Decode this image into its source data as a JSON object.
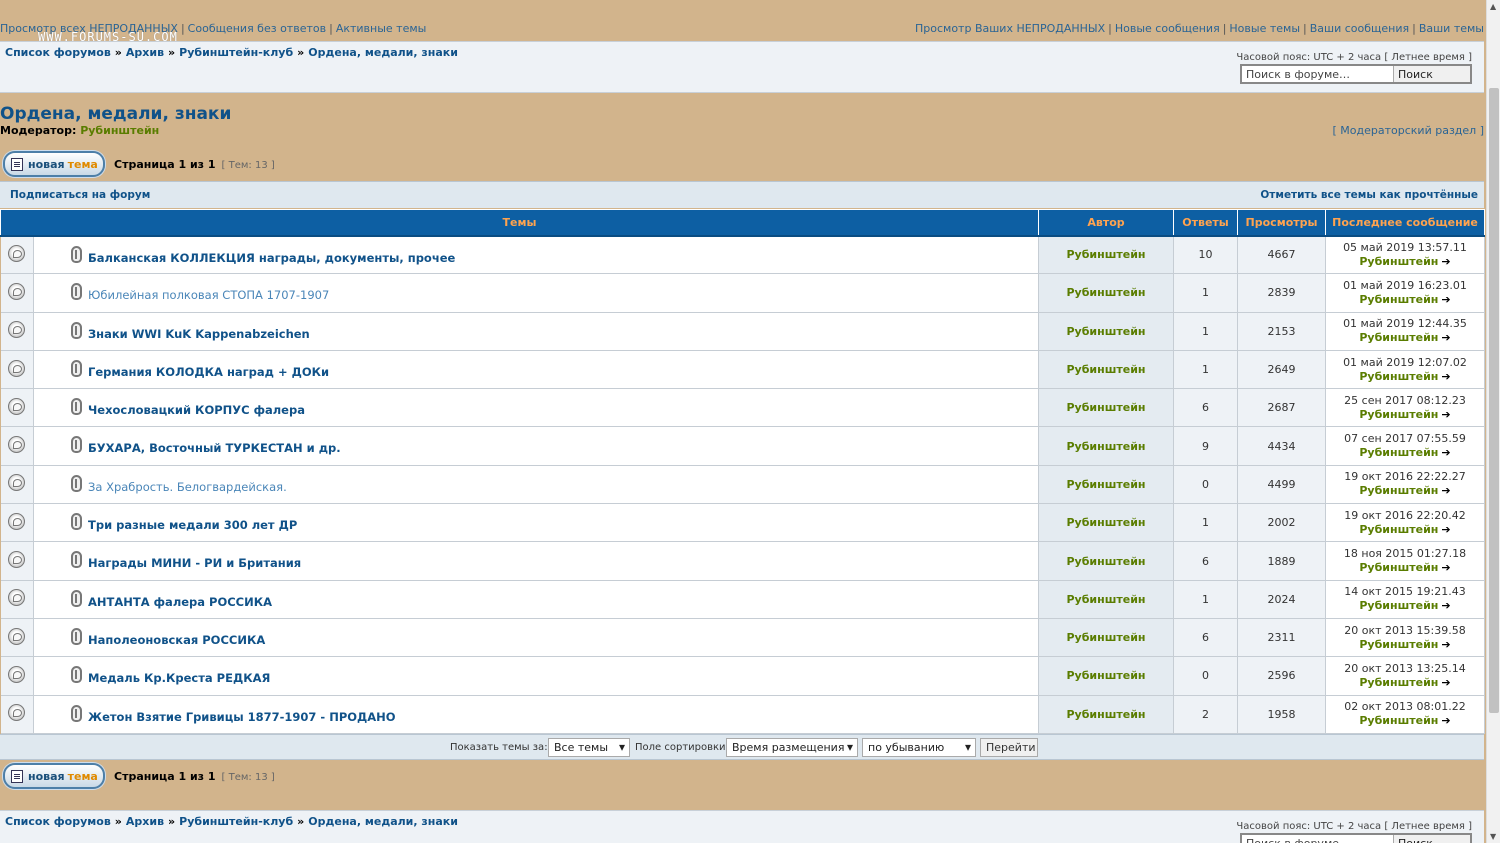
{
  "topnav": {
    "left": [
      "Просмотр всех НЕПРОДАННЫХ",
      "Сообщения без ответов",
      "Активные темы"
    ],
    "right": [
      "Просмотр Ваших НЕПРОДАННЫХ",
      "Новые сообщения",
      "Новые темы",
      "Ваши сообщения",
      "Ваши темы"
    ],
    "watermark": "WWW.FORUMS-SU.COM"
  },
  "breadcrumb": [
    "Список форумов",
    "Архив",
    "Рубинштейн-клуб",
    "Ордена, медали, знаки"
  ],
  "timezone": "Часовой пояс: UTC + 2 часа [ Летнее время ]",
  "search": {
    "placeholder": "Поиск в форуме…",
    "button": "Поиск"
  },
  "forum": {
    "title": "Ордена, медали, знаки",
    "moderator_label": "Модератор:",
    "moderator_name": "Рубинштейн",
    "mod_section": "[ Модераторский раздел ]"
  },
  "new_topic": {
    "part1": "новая",
    "part2": "тема"
  },
  "pagination": {
    "page": "Страница 1 из 1",
    "count": "[ Тем: 13 ]"
  },
  "subscribe": "Подписаться на форум",
  "mark_read": "Отметить все темы как прочтённые",
  "columns": [
    "Темы",
    "Автор",
    "Ответы",
    "Просмотры",
    "Последнее сообщение"
  ],
  "topics": [
    {
      "title": "Балканская КОЛЛЕКЦИЯ награды, документы, прочее",
      "visited": false,
      "author": "Рубинштейн",
      "replies": "10",
      "views": "4667",
      "last_date": "05 май 2019 13:57.11",
      "last_by": "Рубинштейн"
    },
    {
      "title": "Юбилейная полковая СТОПА 1707-1907",
      "visited": true,
      "author": "Рубинштейн",
      "replies": "1",
      "views": "2839",
      "last_date": "01 май 2019 16:23.01",
      "last_by": "Рубинштейн"
    },
    {
      "title": "Знаки WWI KuK Kappenabzeichen",
      "visited": false,
      "author": "Рубинштейн",
      "replies": "1",
      "views": "2153",
      "last_date": "01 май 2019 12:44.35",
      "last_by": "Рубинштейн"
    },
    {
      "title": "Германия КОЛОДКА наград + ДОКи",
      "visited": false,
      "author": "Рубинштейн",
      "replies": "1",
      "views": "2649",
      "last_date": "01 май 2019 12:07.02",
      "last_by": "Рубинштейн"
    },
    {
      "title": "Чехословацкий КОРПУС фалера",
      "visited": false,
      "author": "Рубинштейн",
      "replies": "6",
      "views": "2687",
      "last_date": "25 сен 2017 08:12.23",
      "last_by": "Рубинштейн"
    },
    {
      "title": "БУХАРА, Восточный ТУРКЕСТАН и др.",
      "visited": false,
      "author": "Рубинштейн",
      "replies": "9",
      "views": "4434",
      "last_date": "07 сен 2017 07:55.59",
      "last_by": "Рубинштейн"
    },
    {
      "title": "За Храбрость. Белогвардейская.",
      "visited": true,
      "author": "Рубинштейн",
      "replies": "0",
      "views": "4499",
      "last_date": "19 окт 2016 22:22.27",
      "last_by": "Рубинштейн"
    },
    {
      "title": "Три разные медали 300 лет ДР",
      "visited": false,
      "author": "Рубинштейн",
      "replies": "1",
      "views": "2002",
      "last_date": "19 окт 2016 22:20.42",
      "last_by": "Рубинштейн"
    },
    {
      "title": "Награды МИНИ - РИ и Британия",
      "visited": false,
      "author": "Рубинштейн",
      "replies": "6",
      "views": "1889",
      "last_date": "18 ноя 2015 01:27.18",
      "last_by": "Рубинштейн"
    },
    {
      "title": "АНТАНТА фалера РОССИКА",
      "visited": false,
      "author": "Рубинштейн",
      "replies": "1",
      "views": "2024",
      "last_date": "14 окт 2015 19:21.43",
      "last_by": "Рубинштейн"
    },
    {
      "title": "Наполеоновская РОССИКА",
      "visited": false,
      "author": "Рубинштейн",
      "replies": "6",
      "views": "2311",
      "last_date": "20 окт 2013 15:39.58",
      "last_by": "Рубинштейн"
    },
    {
      "title": "Медаль Кр.Креста РЕДКАЯ",
      "visited": false,
      "author": "Рубинштейн",
      "replies": "0",
      "views": "2596",
      "last_date": "20 окт 2013 13:25.14",
      "last_by": "Рубинштейн"
    },
    {
      "title": "Жетон Взятие Гривицы 1877-1907 - ПРОДАНО",
      "visited": false,
      "author": "Рубинштейн",
      "replies": "2",
      "views": "1958",
      "last_date": "02 окт 2013 08:01.22",
      "last_by": "Рубинштейн"
    }
  ],
  "filter": {
    "show_label": "Показать темы за:",
    "show_value": "Все темы",
    "sort_label": "Поле сортировки",
    "sort_value": "Время размещения",
    "order_value": "по убыванию",
    "go": "Перейти"
  },
  "icons": {
    "topic": "topic-read-icon",
    "attachment": "paperclip-icon",
    "goto_last": "goto-last-post-icon",
    "new_topic": "new-topic-icon"
  },
  "colors": {
    "header_blue": "#0d5fa3",
    "header_text": "#ffa34f",
    "page_bg": "#d2b48c",
    "author_green": "#5a7d00",
    "link_blue": "#105289"
  }
}
